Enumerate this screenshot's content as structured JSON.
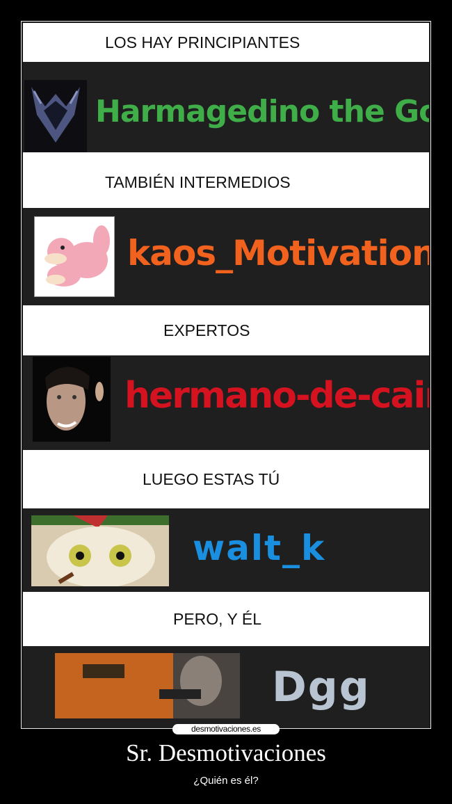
{
  "rows": [
    {
      "caption": "LOS HAY PRINCIPIANTES",
      "username": "Harmagedino the God",
      "color": "#3fae49"
    },
    {
      "caption": "TAMBIÉN INTERMEDIOS",
      "username": "kaos_Motivation",
      "color": "#f0621e"
    },
    {
      "caption": "EXPERTOS",
      "username": "hermano-de-cain",
      "color": "#d5121f"
    },
    {
      "caption": "LUEGO ESTAS TÚ",
      "username": "walt_k",
      "color": "#1a8fe0"
    },
    {
      "caption": "PERO, Y ÉL",
      "username": "Dgg",
      "color": "#b9c4d2"
    }
  ],
  "watermark": "desmotivaciones.es",
  "footer": {
    "title": "Sr. Desmotivaciones",
    "subtitle": "¿Quién es él?"
  },
  "icons": {
    "avatar1": "dark-heart-emblem-icon",
    "avatar2": "pink-pokemon-avatar",
    "avatar3": "man-face-avatar",
    "avatar4": "cat-face-avatar",
    "avatar5": "soldier-avatar"
  }
}
